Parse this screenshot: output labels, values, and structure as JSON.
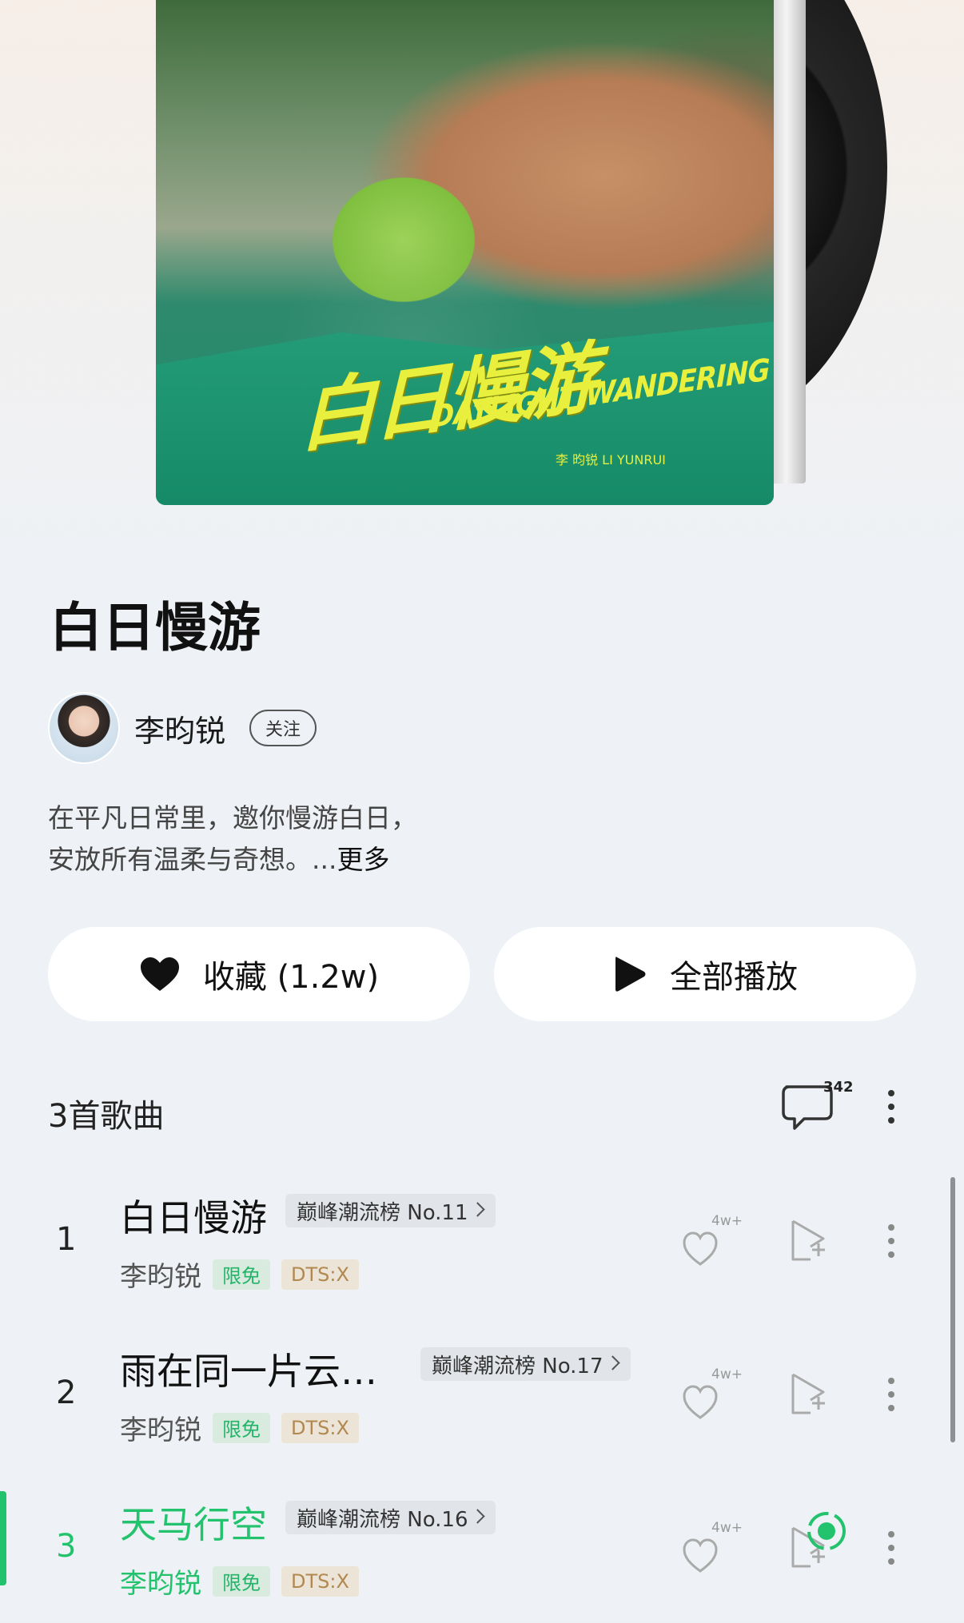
{
  "album": {
    "cover_title": "白日慢游",
    "cover_subtitle": "DAYLIGHT WANDERING",
    "cover_artist": "李  昀锐    LI YUNRUI",
    "title": "白日慢游"
  },
  "artist": {
    "name": "李昀锐",
    "follow_label": "关注"
  },
  "description": {
    "line1": "在平凡日常里，邀你慢游白日，",
    "line2": "安放所有温柔与奇想。...",
    "more": "更多"
  },
  "actions": {
    "favorite_label": "收藏 (1.2w)",
    "play_all_label": "全部播放"
  },
  "tracklist": {
    "count_label": "3首歌曲",
    "comment_count": "342",
    "tracks": [
      {
        "num": "1",
        "title": "白日慢游",
        "rank": "巅峰潮流榜 No.11",
        "singer": "李昀锐",
        "tag_free": "限免",
        "tag_dts": "DTS:X",
        "likes": "4w+"
      },
      {
        "num": "2",
        "title": "雨在同一片云…",
        "rank": "巅峰潮流榜 No.17",
        "singer": "李昀锐",
        "tag_free": "限免",
        "tag_dts": "DTS:X",
        "likes": "4w+"
      },
      {
        "num": "3",
        "title": "天马行空",
        "rank": "巅峰潮流榜 No.16",
        "singer": "李昀锐",
        "tag_free": "限免",
        "tag_dts": "DTS:X",
        "likes": "4w+",
        "playing": true
      }
    ]
  },
  "colors": {
    "accent": "#23c36e",
    "background": "#eef1f5",
    "cover_title": "#e8ef3c"
  }
}
